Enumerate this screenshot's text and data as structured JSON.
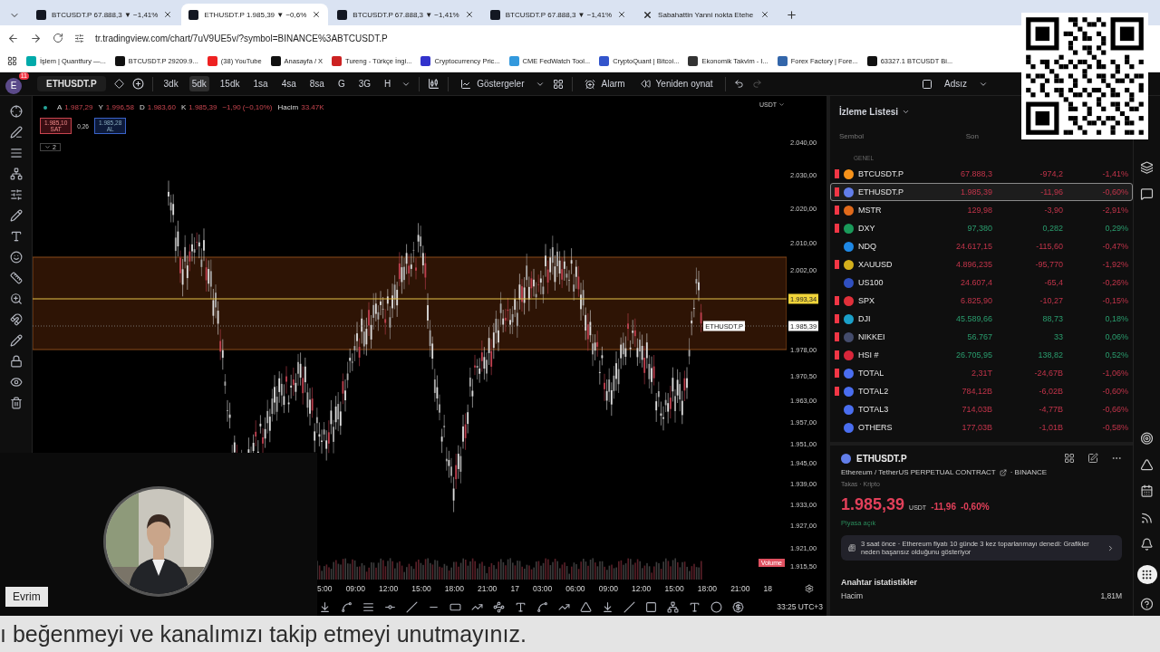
{
  "browser": {
    "tabs": [
      {
        "title": "BTCUSDT.P 67.888,3 ▼ −1,41%",
        "kind": "tradingview",
        "selected": false
      },
      {
        "title": "ETHUSDT.P 1.985,39 ▼ −0,6%",
        "kind": "tradingview",
        "selected": true
      },
      {
        "title": "BTCUSDT.P 67.888,3 ▼ −1,41%",
        "kind": "tradingview",
        "selected": false
      },
      {
        "title": "BTCUSDT.P 67.888,3 ▼ −1,41%",
        "kind": "tradingview",
        "selected": false
      },
      {
        "title": "Sabahattin Yanni nokta Etehe",
        "kind": "x",
        "selected": false
      }
    ],
    "url": "tr.tradingview.com/chart/7uV9UE5v/?symbol=BINANCE%3ABTCUSDT.P",
    "bookmarks": [
      "İşlem | Quantfury —...",
      "BTCUSDT.P 29209.9...",
      "(38) YouTube",
      "Anasayfa / X",
      "Tureng - Türkçe İngi...",
      "Cryptocurrency Pric...",
      "CME FedWatch Tool...",
      "CryptoQuant | Bitcoi...",
      "Ekonomik Takvim - I...",
      "Forex Factory | Fore...",
      "63327.1 BTCUSDT Bi..."
    ]
  },
  "toolbar": {
    "avatar": "E",
    "badge": "11",
    "symbol": "ETHUSDT.P",
    "intervals": [
      {
        "label": "3dk",
        "selected": false
      },
      {
        "label": "5dk",
        "selected": true
      },
      {
        "label": "15dk",
        "selected": false
      },
      {
        "label": "1sa",
        "selected": false
      },
      {
        "label": "4sa",
        "selected": false
      },
      {
        "label": "8sa",
        "selected": false
      },
      {
        "label": "G",
        "selected": false
      },
      {
        "label": "3G",
        "selected": false
      },
      {
        "label": "H",
        "selected": false
      }
    ],
    "indicators": "Göstergeler",
    "alert": "Alarm",
    "replay": "Yeniden oynat",
    "layout": "Adsız"
  },
  "chart": {
    "legend": {
      "ohlc": [
        {
          "key": "A",
          "value": "1.987,29"
        },
        {
          "key": "Y",
          "value": "1.996,58"
        },
        {
          "key": "D",
          "value": "1.983,60"
        },
        {
          "key": "K",
          "value": "1.985,39"
        }
      ],
      "change": "−1,90 (−0,10%)",
      "volume_label": "Hacim",
      "volume": "33.47K"
    },
    "order": {
      "sell_price": "1.985,10",
      "sell_label": "SAT",
      "spread": "0,26",
      "buy_price": "1.985,28",
      "buy_label": "AL"
    },
    "collapsed": "2",
    "currency": "USDT",
    "price_axis": [
      {
        "label": "2.040,00",
        "kind": "tick"
      },
      {
        "label": "2.030,00",
        "kind": "tick"
      },
      {
        "label": "2.020,00",
        "kind": "tick"
      },
      {
        "label": "2.010,00",
        "kind": "tick"
      },
      {
        "label": "2.002,00",
        "kind": "tick"
      },
      {
        "label": "1.993,34",
        "kind": "alert"
      },
      {
        "label": "1.985,39",
        "kind": "last",
        "symbol": "ETHUSDT.P"
      },
      {
        "label": "1.978,00",
        "kind": "tick"
      },
      {
        "label": "1.970,50",
        "kind": "tick"
      },
      {
        "label": "1.963,00",
        "kind": "tick"
      },
      {
        "label": "1.957,00",
        "kind": "tick"
      },
      {
        "label": "1.951,00",
        "kind": "tick"
      },
      {
        "label": "1.945,00",
        "kind": "tick"
      },
      {
        "label": "1.939,00",
        "kind": "tick"
      },
      {
        "label": "1.933,00",
        "kind": "tick"
      },
      {
        "label": "1.927,00",
        "kind": "tick"
      },
      {
        "label": "1.921,00",
        "kind": "tick"
      },
      {
        "label": "1.915,50",
        "kind": "tick"
      }
    ],
    "time_axis": [
      "5:00",
      "09:00",
      "12:00",
      "15:00",
      "18:00",
      "21:00",
      "17",
      "03:00",
      "06:00",
      "09:00",
      "12:00",
      "15:00",
      "18:00",
      "21:00",
      "18"
    ],
    "volume_tag": "Volume",
    "clock": "33:25 UTC+3"
  },
  "watchlist": {
    "title": "İzleme Listesi",
    "columns": [
      "Sembol",
      "Son"
    ],
    "section": "GENEL",
    "rows": [
      {
        "symbol": "BTCUSDT.P",
        "price": "67.888,3",
        "change": "-974,2",
        "percent": "-1,41%",
        "kind": "down",
        "flagged": true,
        "color": "#f7931a",
        "selected": false
      },
      {
        "symbol": "ETHUSDT.P",
        "price": "1.985,39",
        "change": "-11,96",
        "percent": "-0,60%",
        "kind": "down",
        "flagged": true,
        "color": "#627eea",
        "selected": true
      },
      {
        "symbol": "MSTR",
        "price": "129,98",
        "change": "-3,90",
        "percent": "-2,91%",
        "kind": "down",
        "flagged": true,
        "color": "#e06a1b",
        "selected": false
      },
      {
        "symbol": "DXY",
        "price": "97,380",
        "change": "0,282",
        "percent": "0,29%",
        "kind": "up",
        "flagged": true,
        "color": "#1a9a5a",
        "selected": false
      },
      {
        "symbol": "NDQ",
        "price": "24.617,15",
        "change": "-115,60",
        "percent": "-0,47%",
        "kind": "down",
        "flagged": false,
        "color": "#1e88e5",
        "selected": false
      },
      {
        "symbol": "XAUUSD",
        "price": "4.896,235",
        "change": "-95,770",
        "percent": "-1,92%",
        "kind": "down",
        "flagged": true,
        "color": "#d4b01c",
        "selected": false
      },
      {
        "symbol": "US100",
        "price": "24.607,4",
        "change": "-65,4",
        "percent": "-0,26%",
        "kind": "down",
        "flagged": false,
        "color": "#3050c0",
        "selected": false
      },
      {
        "symbol": "SPX",
        "price": "6.825,90",
        "change": "-10,27",
        "percent": "-0,15%",
        "kind": "down",
        "flagged": true,
        "color": "#e0303a",
        "selected": false
      },
      {
        "symbol": "DJI",
        "price": "45.589,66",
        "change": "88,73",
        "percent": "0,18%",
        "kind": "up",
        "flagged": true,
        "color": "#1ba0c9",
        "selected": false
      },
      {
        "symbol": "NIKKEI",
        "price": "56.767",
        "change": "33",
        "percent": "0,06%",
        "kind": "up",
        "flagged": true,
        "color": "#444c6c",
        "selected": false
      },
      {
        "symbol": "HSI #",
        "price": "26.705,95",
        "change": "138,82",
        "percent": "0,52%",
        "kind": "up",
        "flagged": true,
        "color": "#d8263a",
        "selected": false
      },
      {
        "symbol": "TOTAL",
        "price": "2,31T",
        "change": "-24,67B",
        "percent": "-1,06%",
        "kind": "down",
        "flagged": true,
        "color": "#4a6ef0",
        "selected": false
      },
      {
        "symbol": "TOTAL2",
        "price": "784,12B",
        "change": "-6,02B",
        "percent": "-0,60%",
        "kind": "down",
        "flagged": true,
        "color": "#4a6ef0",
        "selected": false
      },
      {
        "symbol": "TOTAL3",
        "price": "714,03B",
        "change": "-4,77B",
        "percent": "-0,66%",
        "kind": "down",
        "flagged": false,
        "color": "#4a6ef0",
        "selected": false
      },
      {
        "symbol": "OTHERS",
        "price": "177,03B",
        "change": "-1,01B",
        "percent": "-0,58%",
        "kind": "down",
        "flagged": false,
        "color": "#4a6ef0",
        "selected": false
      }
    ]
  },
  "details": {
    "symbol": "ETHUSDT.P",
    "description": "Ethereum / TetherUS PERPETUAL CONTRACT",
    "exchange": "· BINANCE",
    "category": "Takas · Kripto",
    "price": "1.985,39",
    "currency": "USDT",
    "change": "-11,96",
    "percent": "-0,60%",
    "market_status": "Piyasa açık",
    "news": "3 saat önce · Ethereum fiyatı 10 günde 3 kez toparlanmayı denedi: Grafikler neden başarısız olduğunu gösteriyor",
    "stats_title": "Anahtar istatistikler",
    "stats": [
      {
        "label": "Hacim",
        "value": "1,81M"
      }
    ]
  },
  "webcam": {
    "name": "Evrim"
  },
  "subtitle": "ı beğenmeyi ve kanalımızı takip etmeyi unutmayınız."
}
